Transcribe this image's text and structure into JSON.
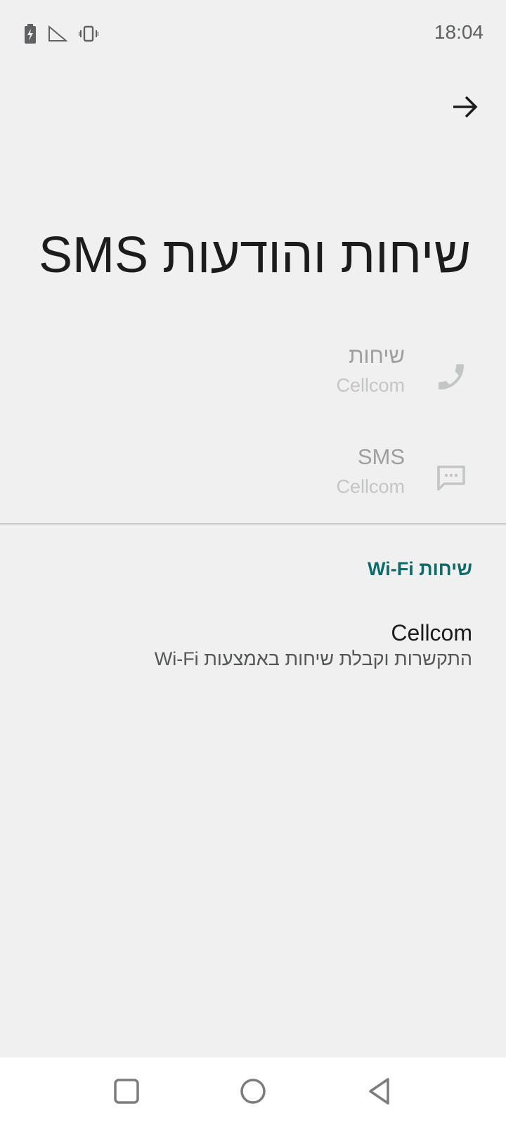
{
  "status_bar": {
    "time": "18:04",
    "icons": [
      "battery-charging-icon",
      "signal-icon",
      "vibrate-icon"
    ]
  },
  "header": {
    "back_icon": "arrow-right-icon"
  },
  "page": {
    "title": "שיחות והודעות SMS"
  },
  "preferences": [
    {
      "title": "שיחות",
      "summary": "Cellcom",
      "icon": "phone-icon"
    },
    {
      "title": "SMS",
      "summary": "Cellcom",
      "icon": "message-icon"
    }
  ],
  "wifi_section": {
    "header": "שיחות Wi-Fi",
    "item": {
      "title": "Cellcom",
      "summary": "התקשרות וקבלת שיחות באמצעות Wi-Fi"
    }
  },
  "nav_bar": {
    "buttons": [
      "recents-icon",
      "home-icon",
      "back-icon"
    ]
  },
  "colors": {
    "background": "#eff0ef",
    "accent": "#0f6a6a",
    "disabled_text": "#9d9e9e"
  }
}
